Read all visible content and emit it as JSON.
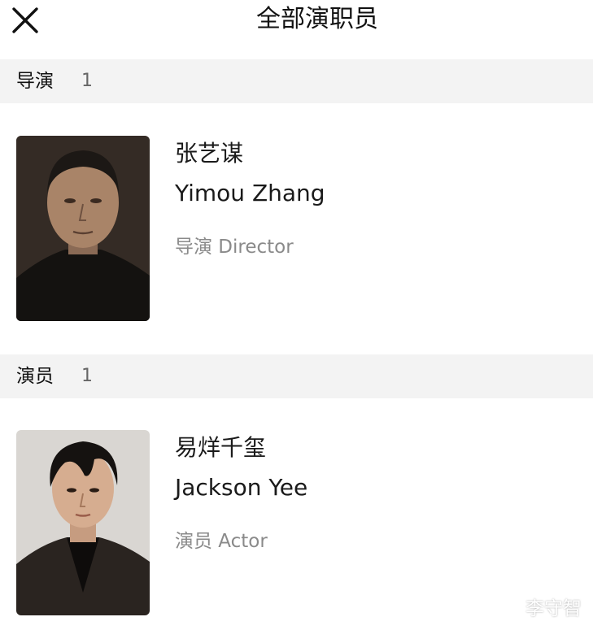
{
  "header": {
    "title": "全部演职员",
    "close_icon": "close-icon"
  },
  "sections": [
    {
      "label": "导演",
      "count": "1",
      "people": [
        {
          "name_cn": "张艺谋",
          "name_en": "Yimou Zhang",
          "role": "导演 Director",
          "photo_tone": "#2c241e"
        }
      ]
    },
    {
      "label": "演员",
      "count": "1",
      "people": [
        {
          "name_cn": "易烊千玺",
          "name_en": "Jackson Yee",
          "role": "演员 Actor",
          "photo_tone": "#d9d6d2"
        }
      ]
    }
  ],
  "watermark": "李守智"
}
